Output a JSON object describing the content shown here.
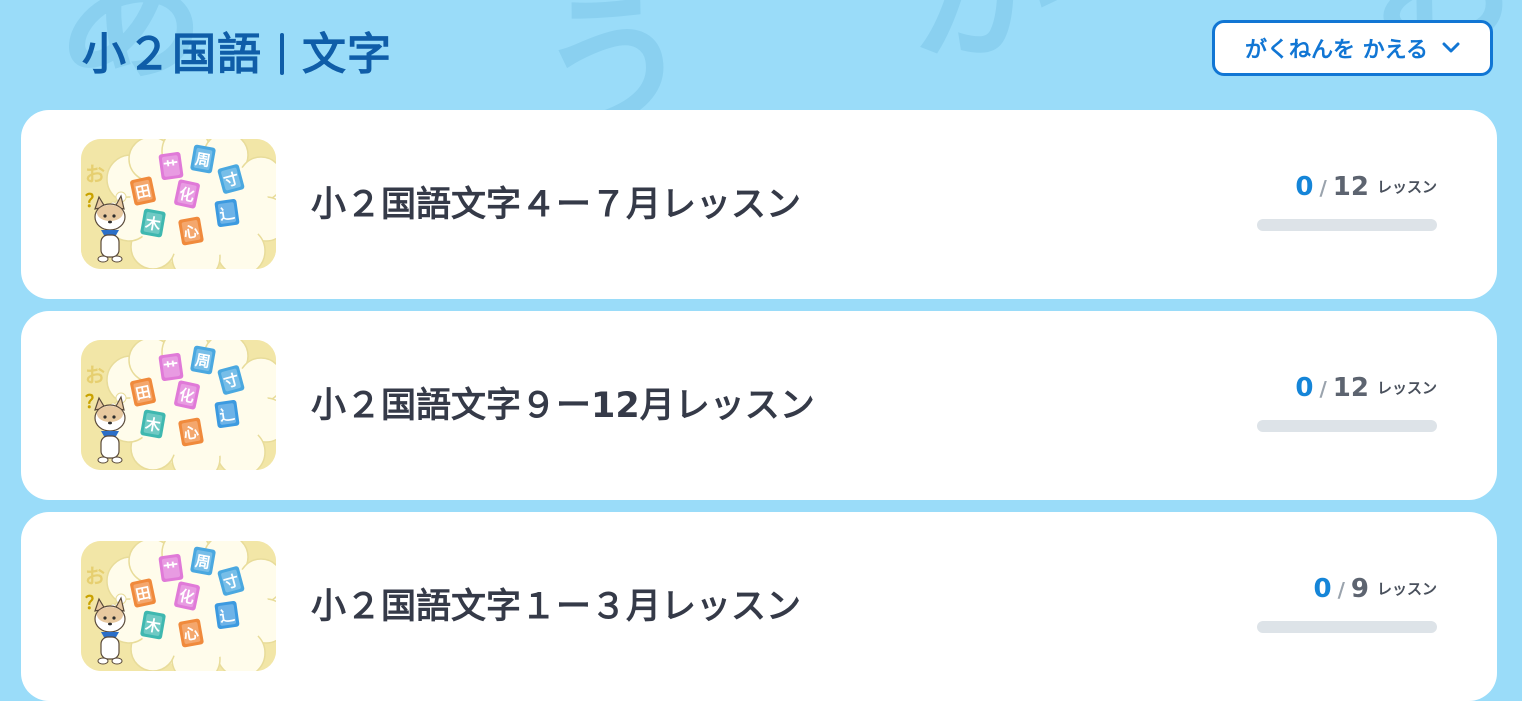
{
  "header": {
    "title_subject": "小２国語",
    "title_category": "文字",
    "grade_button_label": "がくねんを かえる"
  },
  "courses": [
    {
      "title": "小２国語文字４ー７月レッスン",
      "done": "0",
      "total": "12",
      "unit": "レッスン",
      "progress": 0
    },
    {
      "title": "小２国語文字９ー12月レッスン",
      "done": "0",
      "total": "12",
      "unit": "レッスン",
      "progress": 0
    },
    {
      "title": "小２国語文字１ー３月レッスン",
      "done": "0",
      "total": "9",
      "unit": "レッスン",
      "progress": 0
    }
  ],
  "thumbnail": {
    "tiles": [
      "田",
      "艹",
      "周",
      "寸",
      "化",
      "木",
      "心",
      "辶"
    ],
    "side_chars": [
      "お",
      "？"
    ]
  },
  "colors": {
    "background": "#9adcf9",
    "title": "#0f5da8",
    "accent": "#1176d4",
    "progress_done": "#1585d8",
    "progress_track": "#dde3e8"
  },
  "icons": {
    "grade_button": "chevron-down-icon",
    "thumbnail": "dog-character-illustration"
  }
}
